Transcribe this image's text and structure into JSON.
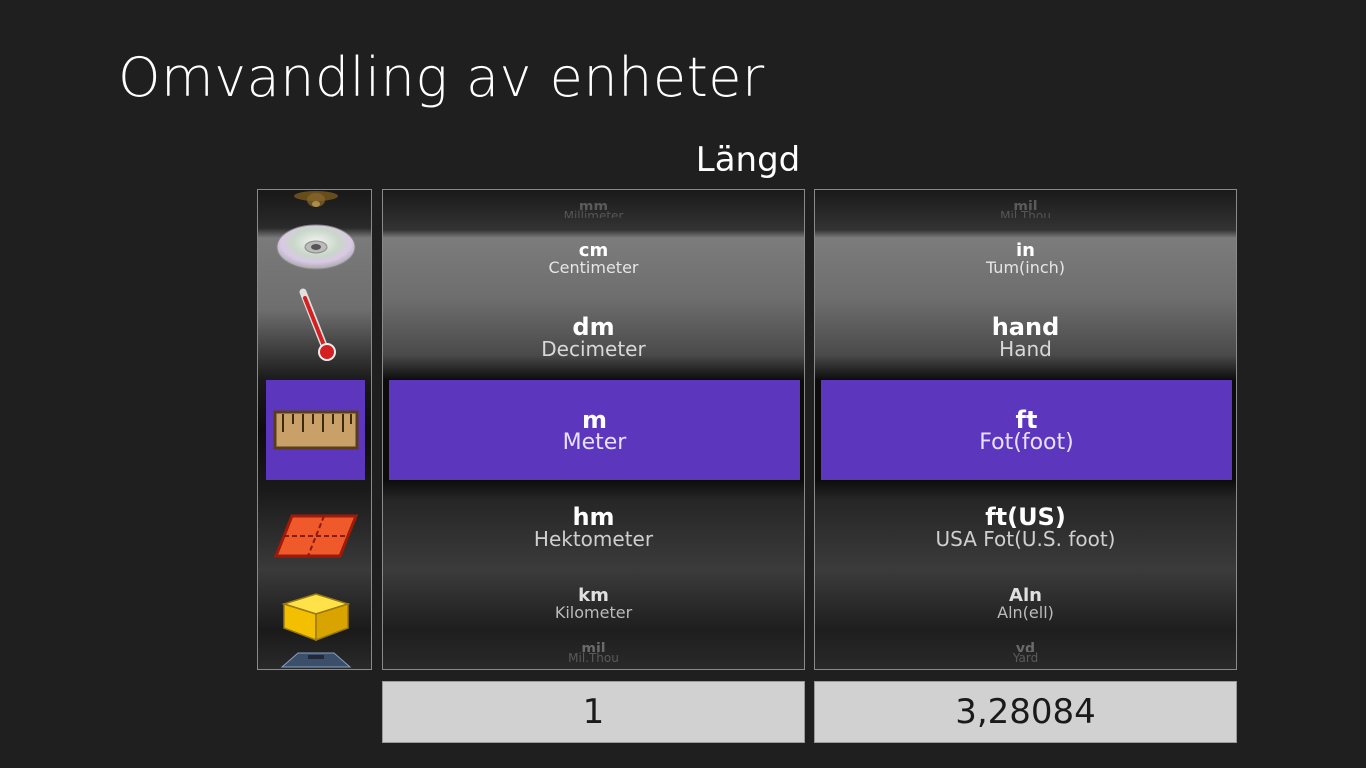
{
  "app": {
    "title": "Omvandling av enheter"
  },
  "category": {
    "title": "Längd"
  },
  "categories": [
    {
      "name": "sound",
      "icon": "speaker-icon"
    },
    {
      "name": "data",
      "icon": "disc-icon"
    },
    {
      "name": "temperature",
      "icon": "thermometer-icon"
    },
    {
      "name": "length",
      "icon": "ruler-icon",
      "selected": true
    },
    {
      "name": "area",
      "icon": "area-tile-icon"
    },
    {
      "name": "volume",
      "icon": "cube-icon"
    },
    {
      "name": "weight",
      "icon": "scale-icon"
    }
  ],
  "from_units": [
    {
      "abbr": "mm",
      "name": "Millimeter"
    },
    {
      "abbr": "cm",
      "name": "Centimeter"
    },
    {
      "abbr": "dm",
      "name": "Decimeter"
    },
    {
      "abbr": "m",
      "name": "Meter",
      "selected": true
    },
    {
      "abbr": "hm",
      "name": "Hektometer"
    },
    {
      "abbr": "km",
      "name": "Kilometer"
    },
    {
      "abbr": "mil",
      "name": "Mil,Thou"
    }
  ],
  "to_units": [
    {
      "abbr": "mil",
      "name": "Mil,Thou"
    },
    {
      "abbr": "in",
      "name": "Tum(inch)"
    },
    {
      "abbr": "hand",
      "name": "Hand"
    },
    {
      "abbr": "ft",
      "name": "Fot(foot)",
      "selected": true
    },
    {
      "abbr": "ft(US)",
      "name": "USA Fot(U.S. foot)"
    },
    {
      "abbr": "Aln",
      "name": "Aln(ell)"
    },
    {
      "abbr": "yd",
      "name": "Yard"
    }
  ],
  "input": {
    "from_value": "1",
    "to_value": "3,28084"
  },
  "colors": {
    "accent": "#5c37be",
    "background": "#1f1f1f",
    "value_box": "#d1d1d1"
  }
}
